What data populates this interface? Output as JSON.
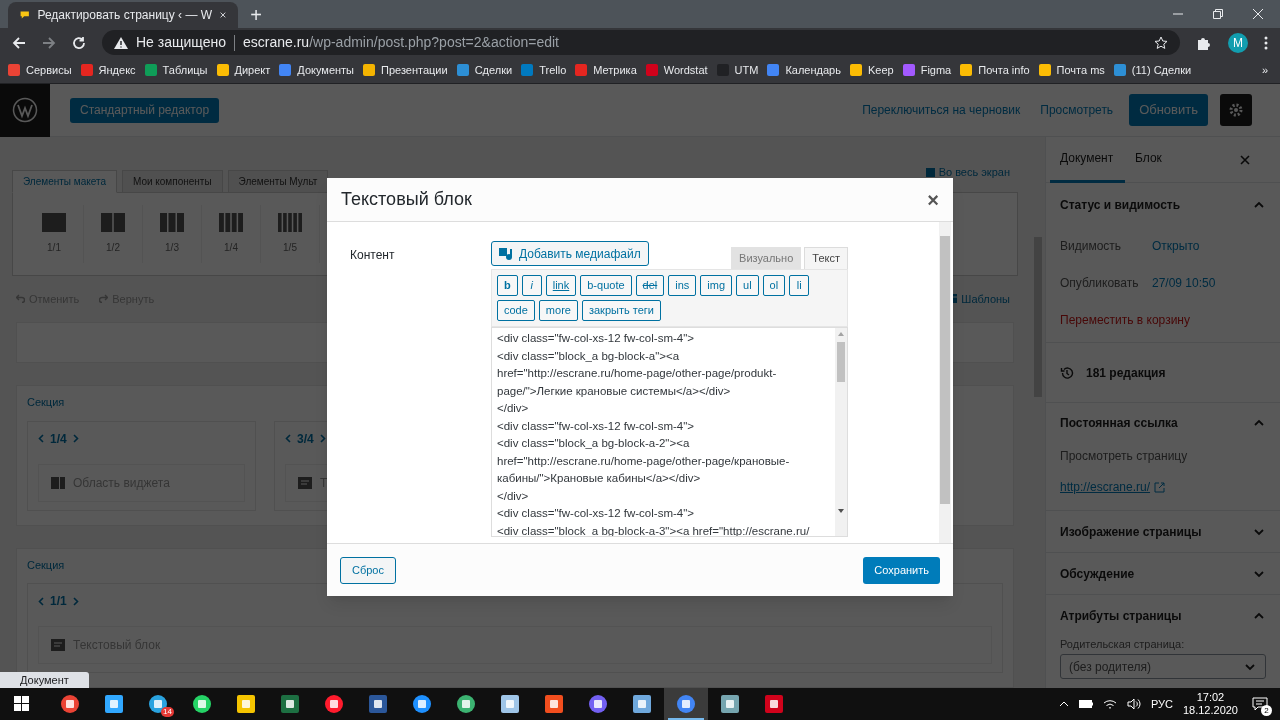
{
  "browser": {
    "tab_title": "Редактировать страницу ‹ — W",
    "new_tab": "+",
    "security": "Не защищено",
    "url_host": "escrane.ru",
    "url_path": "/wp-admin/post.php?post=2&action=edit",
    "profile": "M",
    "more": "»",
    "bookmarks": [
      {
        "label": "Сервисы",
        "color": "#ea4335"
      },
      {
        "label": "Яндекс",
        "color": "#e52620"
      },
      {
        "label": "Таблицы",
        "color": "#0f9d58"
      },
      {
        "label": "Директ",
        "color": "#fbbc04"
      },
      {
        "label": "Документы",
        "color": "#4285f4"
      },
      {
        "label": "Презентации",
        "color": "#f4b400"
      },
      {
        "label": "Сделки",
        "color": "#2d8fd5"
      },
      {
        "label": "Trello",
        "color": "#0079bf"
      },
      {
        "label": "Метрика",
        "color": "#e52620"
      },
      {
        "label": "Wordstat",
        "color": "#d0021b"
      },
      {
        "label": "UTM",
        "color": "#202124"
      },
      {
        "label": "Календарь",
        "color": "#4285f4"
      },
      {
        "label": "Keep",
        "color": "#fbbc04"
      },
      {
        "label": "Figma",
        "color": "#a259ff"
      },
      {
        "label": "Почта info",
        "color": "#fbbc04"
      },
      {
        "label": "Почта ms",
        "color": "#fbbc04"
      },
      {
        "label": "(11) Сделки",
        "color": "#2d8fd5"
      }
    ]
  },
  "header": {
    "standard_editor": "Стандартный редактор",
    "switch_draft": "Переключиться на черновик",
    "preview": "Просмотреть",
    "update": "Обновить"
  },
  "builder": {
    "tabs": [
      {
        "label": "Элементы макета",
        "selected": true
      },
      {
        "label": "Мои компоненты",
        "selected": false
      },
      {
        "label": "Элементы Мульт",
        "selected": false
      }
    ],
    "fullscreen": "Во весь экран",
    "columns": [
      "1/1",
      "1/2",
      "1/3",
      "1/4",
      "1/5"
    ],
    "undo": "Отменить",
    "redo": "Вернуть",
    "templates": "Шаблоны",
    "sections": [
      {
        "title": "Секция",
        "columns": [
          {
            "label": "1/4",
            "element": "Область виджета",
            "kind": "widget"
          },
          {
            "label": "3/4",
            "element": "Т",
            "kind": "text"
          }
        ]
      },
      {
        "title": "Секция",
        "columns": [
          {
            "label": "1/1",
            "element": "Текстовый блок",
            "kind": "text"
          }
        ]
      }
    ]
  },
  "sidebar": {
    "tabs": [
      {
        "label": "Документ",
        "selected": true
      },
      {
        "label": "Блок",
        "selected": false
      }
    ],
    "status_title": "Статус и видимость",
    "visibility_label": "Видимость",
    "visibility_value": "Открыто",
    "publish_label": "Опубликовать",
    "publish_value": "27/09 10:50",
    "trash": "Переместить в корзину",
    "revisions": "181 редакция",
    "permalink_title": "Постоянная ссылка",
    "view_page": "Просмотреть страницу",
    "permalink_url": "http://escrane.ru/",
    "image_title": "Изображение страницы",
    "discussion_title": "Обсуждение",
    "attributes_title": "Атрибуты страницы",
    "parent_label": "Родительская страница:",
    "parent_value": "(без родителя)"
  },
  "modal": {
    "title": "Текстовый блок",
    "close": "×",
    "field_label": "Контент",
    "add_media": "Добавить медиафайл",
    "editor_tabs": [
      {
        "label": "Визуально",
        "selected": false
      },
      {
        "label": "Текст",
        "selected": true
      }
    ],
    "quicktags": [
      {
        "label": "b",
        "kind": "bold"
      },
      {
        "label": "i",
        "kind": "italic"
      },
      {
        "label": "link",
        "kind": "underline"
      },
      {
        "label": "b-quote",
        "kind": "plain"
      },
      {
        "label": "del",
        "kind": "strike"
      },
      {
        "label": "ins",
        "kind": "plain"
      },
      {
        "label": "img",
        "kind": "plain"
      },
      {
        "label": "ul",
        "kind": "plain"
      },
      {
        "label": "ol",
        "kind": "plain"
      },
      {
        "label": "li",
        "kind": "plain"
      },
      {
        "label": "code",
        "kind": "plain"
      },
      {
        "label": "more",
        "kind": "plain"
      },
      {
        "label": "закрыть теги",
        "kind": "plain"
      }
    ],
    "lines": [
      "<div class=\"fw-col-xs-12 fw-col-sm-4\">",
      "<div class=\"block_a bg-block-a\"><a",
      "href=\"http://escrane.ru/home-page/other-page/produkt-",
      "page/\">Легкие крановые системы</a></div>",
      "</div>",
      "<div class=\"fw-col-xs-12 fw-col-sm-4\">",
      "<div class=\"block_a bg-block-a-2\"><a",
      "href=\"http://escrane.ru/home-page/other-page/крановые-",
      "кабины/\">Крановые кабины</a></div>",
      "</div>",
      "<div class=\"fw-col-xs-12 fw-col-sm-4\">",
      "<div class=\"block_a bg-block-a-3\"><a href=\"http://escrane.ru/"
    ],
    "reset": "Сброс",
    "save": "Сохранить"
  },
  "status_bubble": "Документ",
  "taskbar": {
    "apps": [
      {
        "kind": "circle",
        "color": "#ea4335",
        "active": false
      },
      {
        "kind": "square",
        "color": "#31a8ff",
        "active": false
      },
      {
        "kind": "circle",
        "color": "#2aa3df",
        "active": false,
        "badge": "14"
      },
      {
        "kind": "circle",
        "color": "#25d366",
        "active": false
      },
      {
        "kind": "square",
        "color": "#f5c400",
        "active": false
      },
      {
        "kind": "square",
        "color": "#1d6f42",
        "active": false
      },
      {
        "kind": "circle",
        "color": "#ff1b2d",
        "active": false
      },
      {
        "kind": "square",
        "color": "#2b579a",
        "active": false
      },
      {
        "kind": "circle",
        "color": "#1e90ff",
        "active": false
      },
      {
        "kind": "circle",
        "color": "#3cb371",
        "active": false
      },
      {
        "kind": "square",
        "color": "#9fc5e8",
        "active": false
      },
      {
        "kind": "square",
        "color": "#f24e1e",
        "active": false
      },
      {
        "kind": "circle",
        "color": "#7360f2",
        "active": false
      },
      {
        "kind": "square",
        "color": "#6fa8dc",
        "active": false
      },
      {
        "kind": "circle",
        "color": "#4285f4",
        "active": true
      },
      {
        "kind": "square",
        "color": "#76a5af",
        "active": false
      },
      {
        "kind": "square",
        "color": "#d0021b",
        "active": false
      }
    ],
    "lang": "РУС",
    "time": "17:02",
    "date": "18.12.2020",
    "notifications": "2"
  }
}
